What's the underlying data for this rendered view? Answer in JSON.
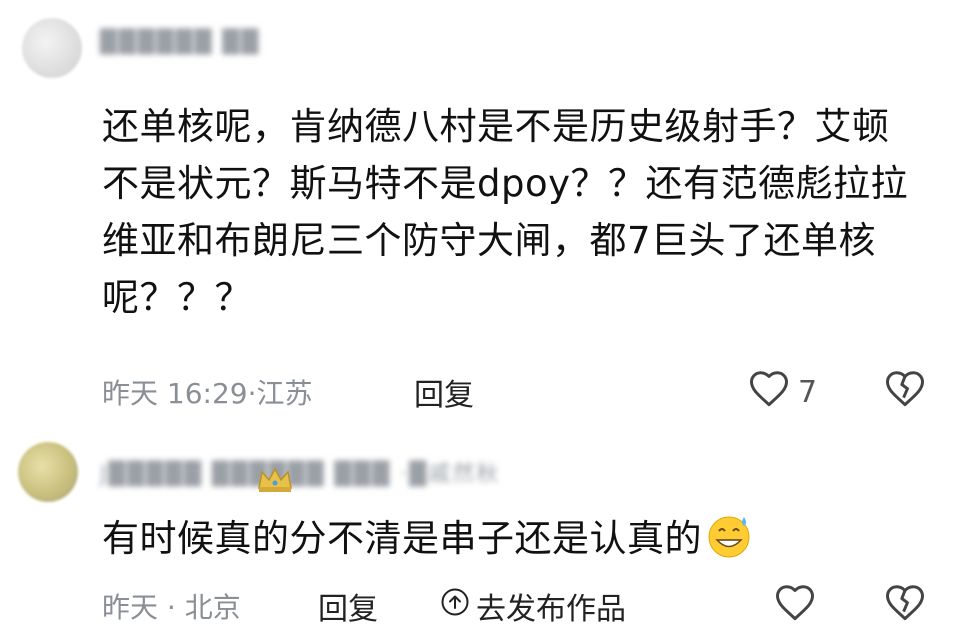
{
  "comments": [
    {
      "author": "██████ ██",
      "text": "还单核呢，肯纳德八村是不是历史级射手？艾顿不是状元？斯马特不是dpoy？？还有范德彪拉拉维亚和布朗尼三个防守大闸，都7巨头了还单核呢？？？",
      "time": "昨天 16:29",
      "location": "江苏",
      "reply_label": "回复",
      "like_count": "7"
    },
    {
      "author": "J█████ ██████ ███ ·█戚然秋",
      "text": "有时候真的分不清是串子还是认真的",
      "emoji": "grinning-sweat-emoji",
      "time": "昨天",
      "location": "北京",
      "reply_label": "回复",
      "publish_label": "去发布作品"
    }
  ],
  "separator": "·",
  "colors": {
    "meta": "#8a8f96",
    "text": "#111111",
    "icon": "#444444"
  }
}
